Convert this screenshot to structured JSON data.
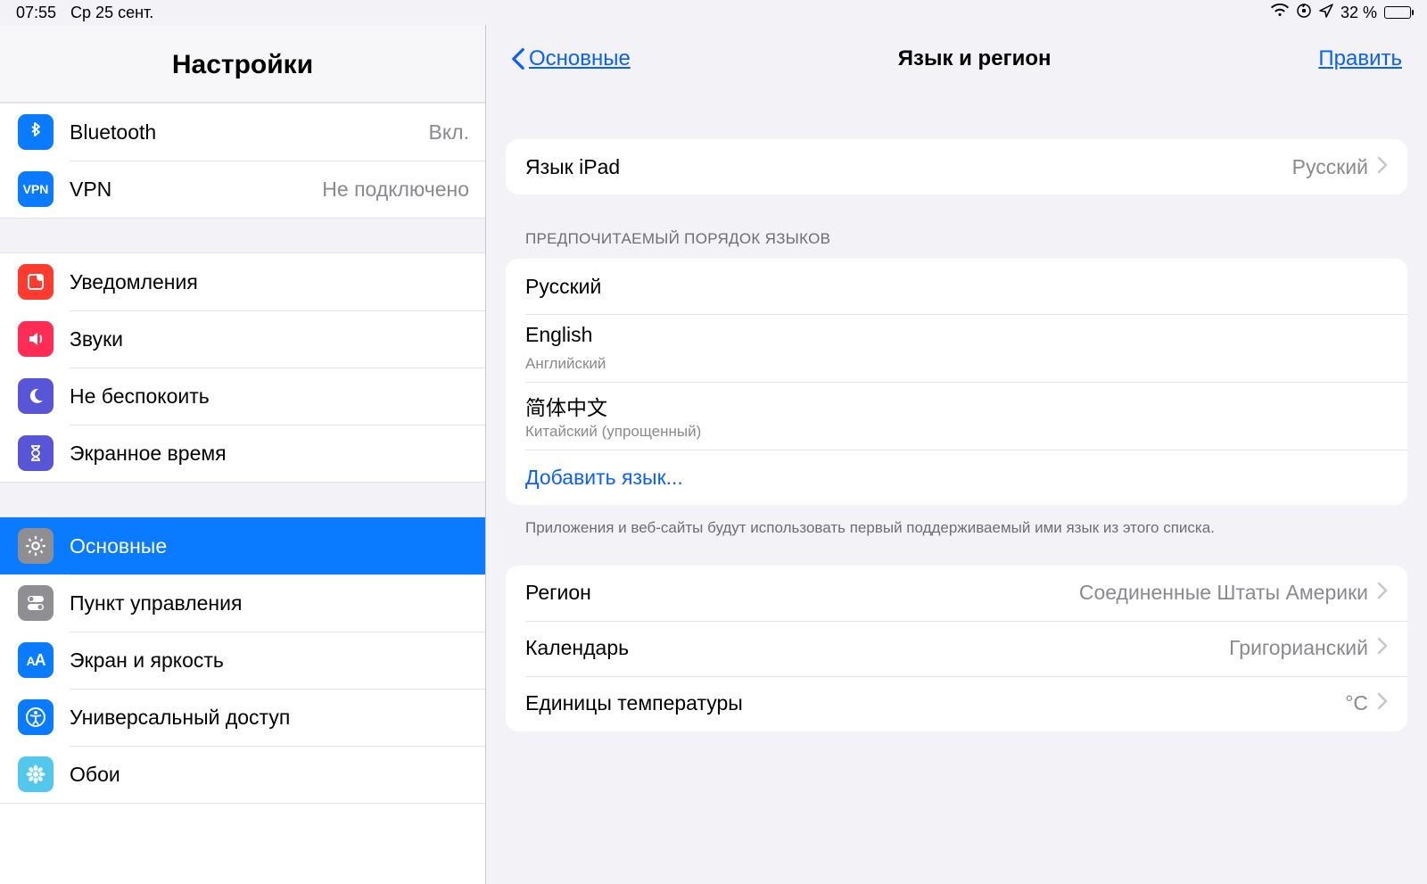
{
  "status": {
    "time": "07:55",
    "date": "Ср 25 сент.",
    "battery_pct": "32 %"
  },
  "sidebar": {
    "title": "Настройки",
    "group1": [
      {
        "id": "bluetooth",
        "label": "Bluetooth",
        "value": "Вкл.",
        "icon": "bluetooth-icon",
        "color": "#0a7aff"
      },
      {
        "id": "vpn",
        "label": "VPN",
        "value": "Не подключено",
        "icon": "vpn-icon",
        "color": "#0a7aff"
      }
    ],
    "group2": [
      {
        "id": "notifications",
        "label": "Уведомления",
        "icon": "notifications-icon",
        "color": "#ff3b30"
      },
      {
        "id": "sounds",
        "label": "Звуки",
        "icon": "sounds-icon",
        "color": "#ff2d55"
      },
      {
        "id": "dnd",
        "label": "Не беспокоить",
        "icon": "moon-icon",
        "color": "#5856d6"
      },
      {
        "id": "screentime",
        "label": "Экранное время",
        "icon": "hourglass-icon",
        "color": "#5856d6"
      }
    ],
    "group3": [
      {
        "id": "general",
        "label": "Основные",
        "icon": "gear-icon",
        "color": "#8e8e93",
        "selected": true
      },
      {
        "id": "control",
        "label": "Пункт управления",
        "icon": "switches-icon",
        "color": "#8e8e93"
      },
      {
        "id": "display",
        "label": "Экран и яркость",
        "icon": "aa-icon",
        "color": "#0a7aff"
      },
      {
        "id": "accessibility",
        "label": "Универсальный доступ",
        "icon": "accessibility-icon",
        "color": "#0a7aff"
      },
      {
        "id": "wallpaper",
        "label": "Обои",
        "icon": "flower-icon",
        "color": "#54c7ec"
      }
    ]
  },
  "detail": {
    "back": "Основные",
    "title": "Язык и регион",
    "edit": "Править",
    "ipad_lang_label": "Язык iPad",
    "ipad_lang_value": "Русский",
    "pref_header": "ПРЕДПОЧИТАЕМЫЙ ПОРЯДОК ЯЗЫКОВ",
    "languages": [
      {
        "title": "Русский",
        "sub": ""
      },
      {
        "title": "English",
        "sub": "Английский"
      },
      {
        "title": "简体中文",
        "sub": "Китайский (упрощенный)"
      }
    ],
    "add_lang": "Добавить язык...",
    "footer": "Приложения и веб-сайты будут использовать первый поддерживаемый ими язык из этого списка.",
    "region_label": "Регион",
    "region_value": "Соединенные Штаты Америки",
    "calendar_label": "Календарь",
    "calendar_value": "Григорианский",
    "temp_label": "Единицы температуры",
    "temp_value": "°C"
  }
}
